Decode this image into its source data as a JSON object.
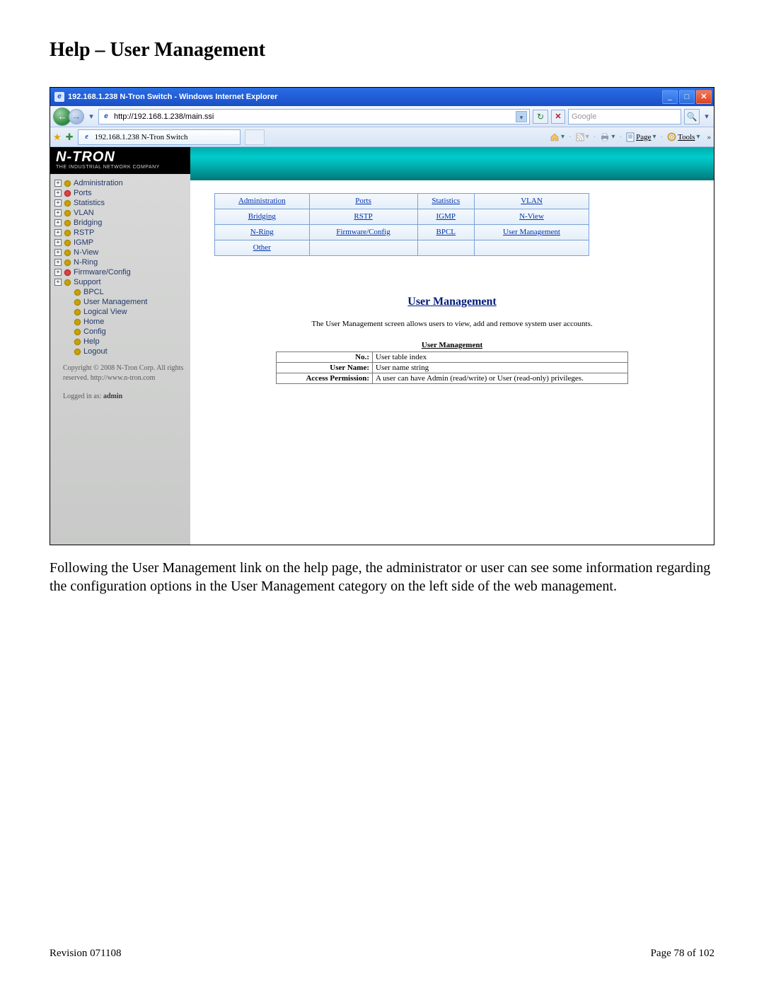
{
  "doc": {
    "heading": "Help – User Management",
    "body_text": "Following the User Management link on the help page, the administrator or user can see some information regarding the configuration options in the User Management category on the left side of the web management.",
    "revision": "Revision 071108",
    "page_label": "Page 78 of 102"
  },
  "window": {
    "title": "192.168.1.238 N-Tron Switch - Windows Internet Explorer",
    "url": "http://192.168.1.238/main.ssi",
    "search_placeholder": "Google",
    "tab_label": "192.168.1.238 N-Tron Switch",
    "toolbar": {
      "page": "Page",
      "tools": "Tools"
    }
  },
  "logo": {
    "brand": "N-TRON",
    "tagline": "THE INDUSTRIAL NETWORK COMPANY"
  },
  "nav": {
    "items": [
      {
        "label": "Administration",
        "exp": true,
        "dot": "y"
      },
      {
        "label": "Ports",
        "exp": true,
        "dot": "r"
      },
      {
        "label": "Statistics",
        "exp": true,
        "dot": "y"
      },
      {
        "label": "VLAN",
        "exp": true,
        "dot": "y"
      },
      {
        "label": "Bridging",
        "exp": true,
        "dot": "y"
      },
      {
        "label": "RSTP",
        "exp": true,
        "dot": "y"
      },
      {
        "label": "IGMP",
        "exp": true,
        "dot": "y"
      },
      {
        "label": "N-View",
        "exp": true,
        "dot": "y"
      },
      {
        "label": "N-Ring",
        "exp": true,
        "dot": "y"
      },
      {
        "label": "Firmware/Config",
        "exp": true,
        "dot": "r"
      },
      {
        "label": "Support",
        "exp": true,
        "dot": "y"
      },
      {
        "label": "BPCL",
        "exp": false,
        "dot": "y",
        "sub": true
      },
      {
        "label": "User Management",
        "exp": false,
        "dot": "y",
        "sub": true
      },
      {
        "label": "Logical View",
        "exp": false,
        "dot": "y",
        "sub": true
      },
      {
        "label": "Home",
        "exp": false,
        "dot": "y",
        "sub": true
      },
      {
        "label": "Config",
        "exp": false,
        "dot": "y",
        "sub": true
      },
      {
        "label": "Help",
        "exp": false,
        "dot": "y",
        "sub": true
      },
      {
        "label": "Logout",
        "exp": false,
        "dot": "y",
        "sub": true
      }
    ],
    "copyright": "Copyright © 2008 N-Tron Corp. All rights reserved. http://www.n-tron.com",
    "logged_in_prefix": "Logged in as: ",
    "logged_in_user": "admin"
  },
  "linkgrid": {
    "rows": [
      [
        "Administration",
        "Ports",
        "Statistics",
        "VLAN"
      ],
      [
        "Bridging",
        "RSTP",
        "IGMP",
        "N-View"
      ],
      [
        "N-Ring",
        "Firmware/Config",
        "BPCL",
        "User Management"
      ],
      [
        "Other",
        "",
        "",
        ""
      ]
    ]
  },
  "panel": {
    "title": "User Management",
    "desc": "The User Management screen allows users to view, add and remove system user accounts.",
    "subtitle": "User Management",
    "fields": [
      {
        "label": "No.:",
        "value": "User table index"
      },
      {
        "label": "User Name:",
        "value": "User name string"
      },
      {
        "label": "Access Permission:",
        "value": "A user can have Admin (read/write) or User (read-only) privileges."
      }
    ]
  }
}
